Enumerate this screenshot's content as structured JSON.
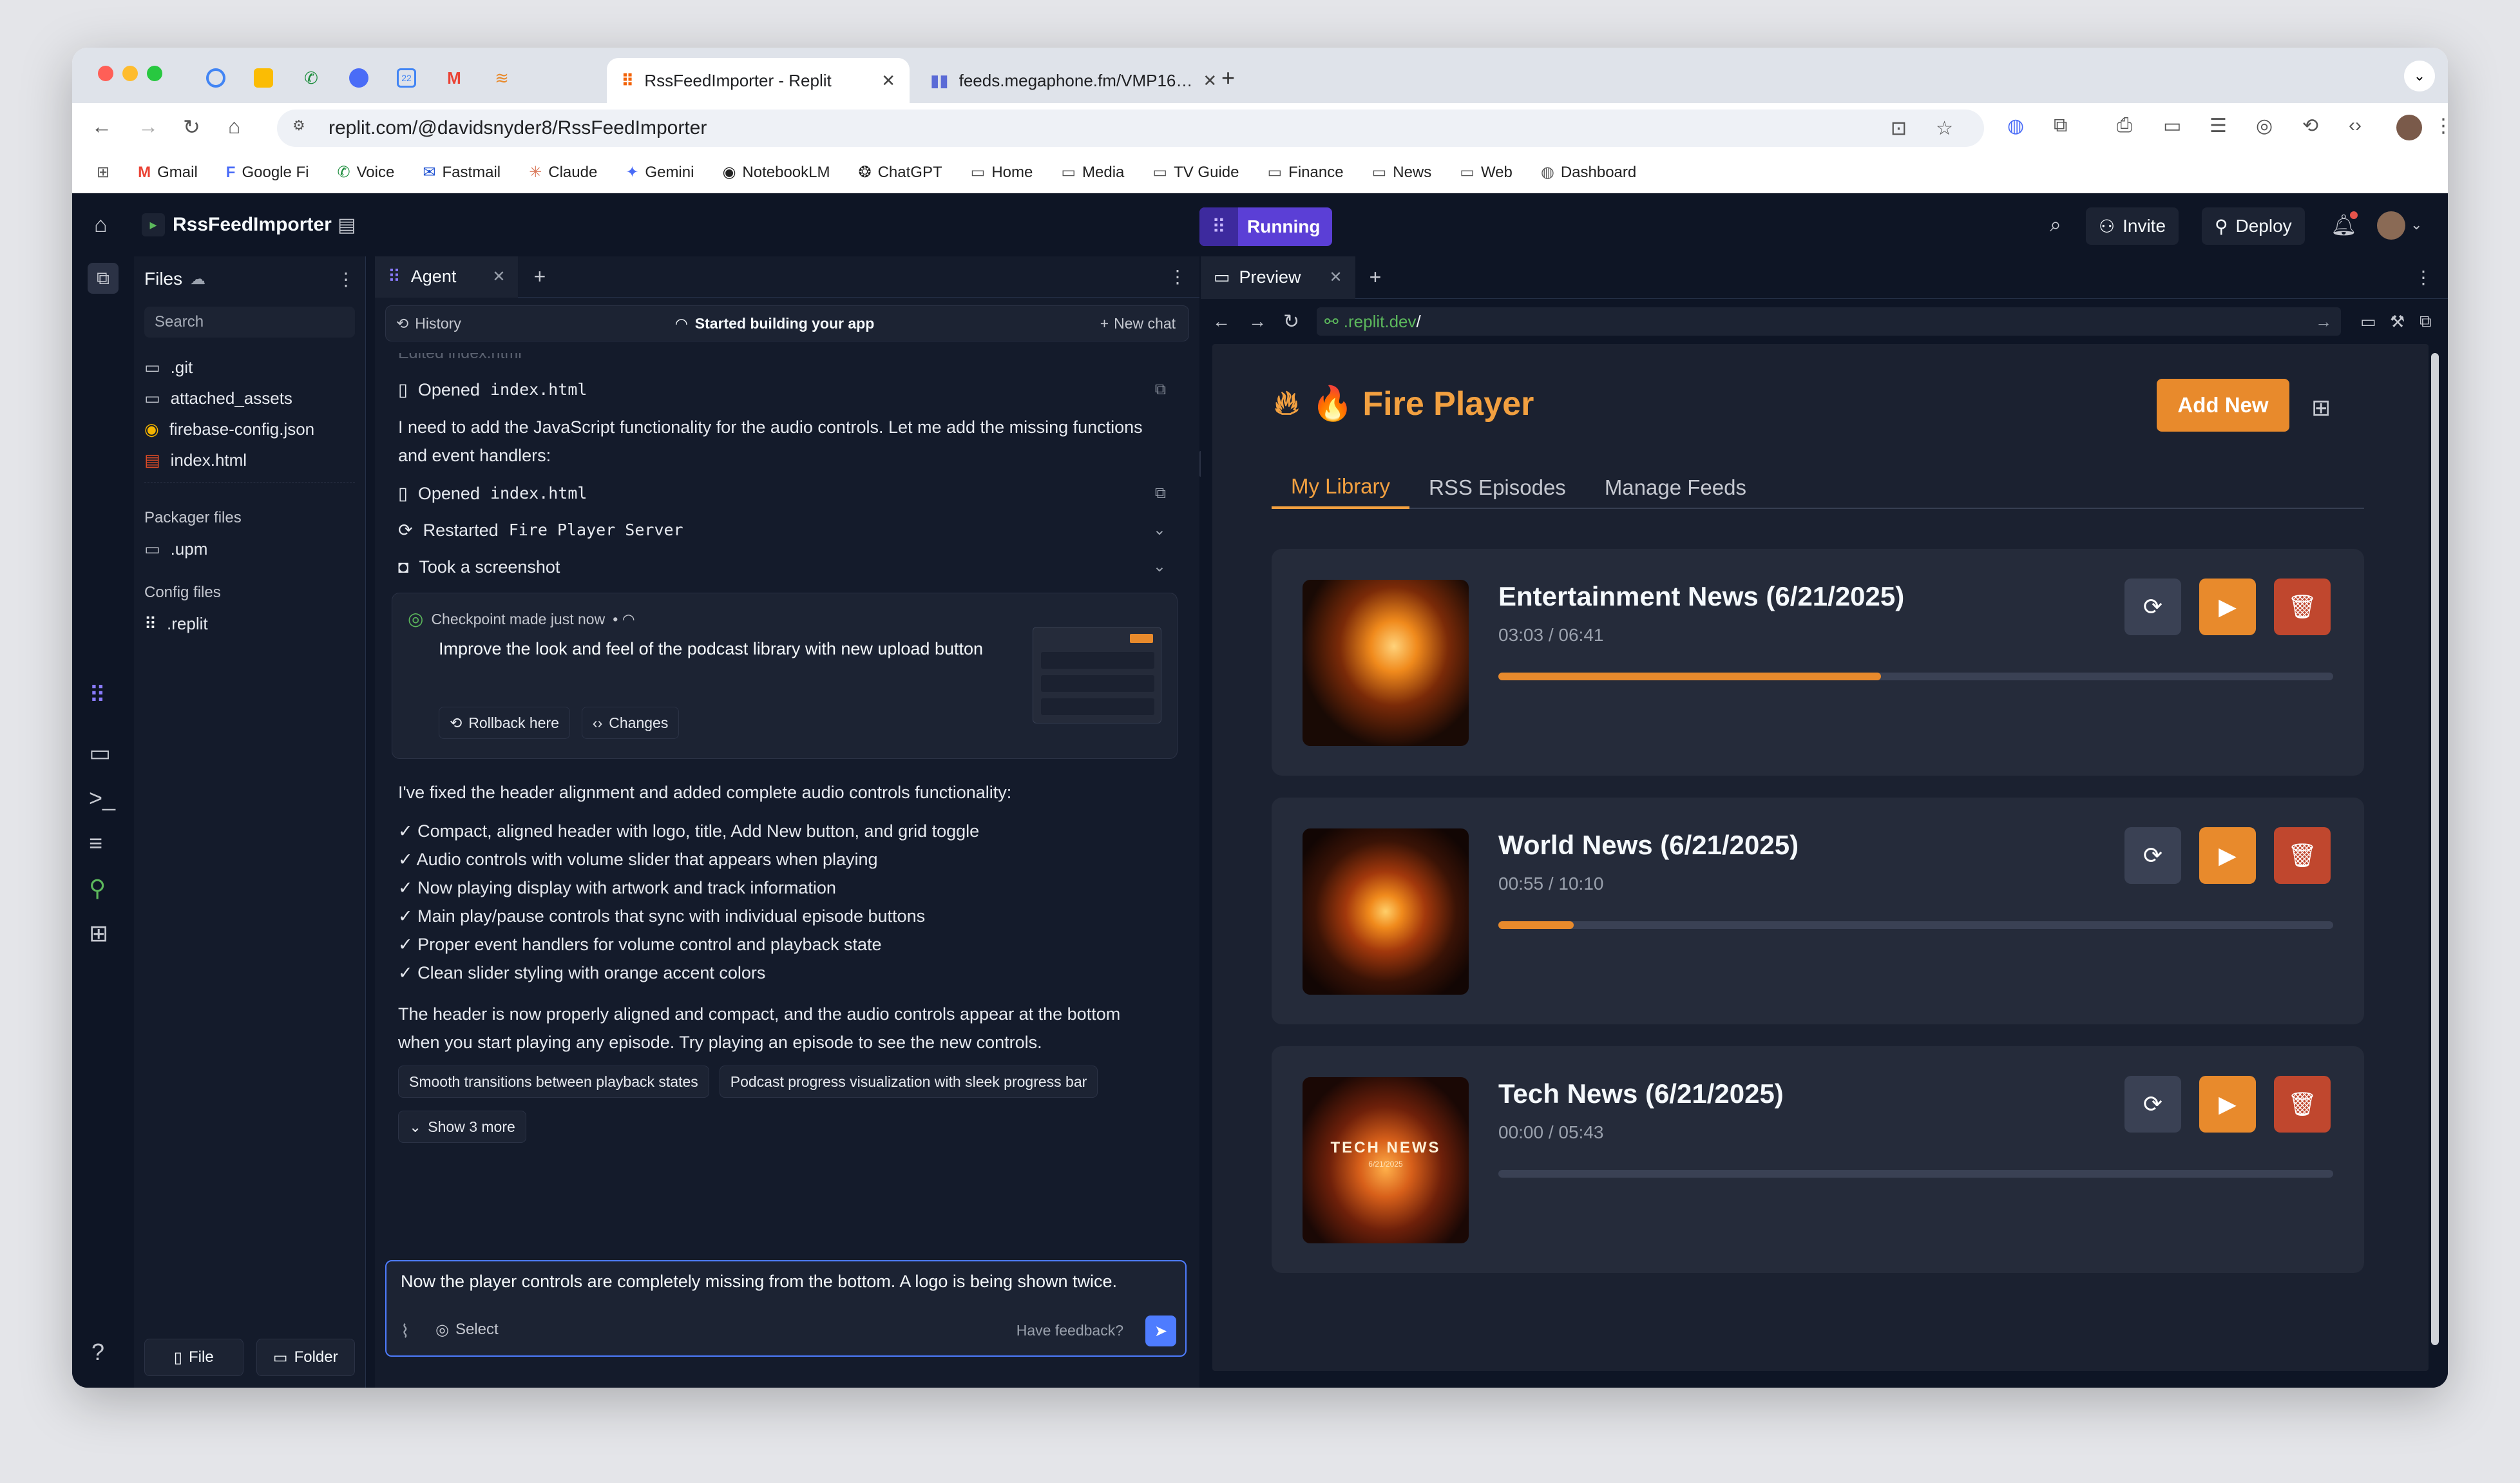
{
  "browser": {
    "pinned_tabs": [
      "task-icon",
      "keep-icon",
      "voice-icon",
      "chat-icon",
      "calendar-icon",
      "gmail-icon",
      "stack-icon"
    ],
    "tabs": [
      {
        "title": "RssFeedImporter - Replit",
        "active": true
      },
      {
        "title": "feeds.megaphone.fm/VMP16…",
        "active": false
      }
    ],
    "url": "replit.com/@davidsnyder8/RssFeedImporter",
    "bookmarks": [
      "Gmail",
      "Google Fi",
      "Voice",
      "Fastmail",
      "Claude",
      "Gemini",
      "NotebookLM",
      "ChatGPT",
      "Home",
      "Media",
      "TV Guide",
      "Finance",
      "News",
      "Web",
      "Dashboard"
    ]
  },
  "app": {
    "project_name": "RssFeedImporter",
    "status": "Running",
    "invite": "Invite",
    "deploy": "Deploy"
  },
  "files": {
    "header": "Files",
    "search_placeholder": "Search",
    "items": [
      ".git",
      "attached_assets",
      "firebase-config.json",
      "index.html"
    ],
    "packager_label": "Packager files",
    "packager_items": [
      ".upm"
    ],
    "config_label": "Config files",
    "config_items": [
      ".replit"
    ],
    "new_file": "File",
    "new_folder": "Folder"
  },
  "agent": {
    "tab_label": "Agent",
    "history": "History",
    "status": "Started building your app",
    "new_chat": "New chat",
    "cut_line": "Edited index.html",
    "act1": {
      "label": "Opened",
      "file": "index.html"
    },
    "msg1": "I need to add the JavaScript functionality for the audio controls. Let me add the missing functions and event handlers:",
    "act2": {
      "label": "Opened",
      "file": "index.html"
    },
    "act3": {
      "label": "Restarted",
      "file": "Fire Player Server"
    },
    "act4": {
      "label": "Took a screenshot"
    },
    "checkpoint": {
      "label": "Checkpoint made just now",
      "desc": "Improve the look and feel of the podcast library with new upload button",
      "rollback": "Rollback here",
      "changes": "Changes"
    },
    "summary_intro": "I've fixed the header alignment and added complete audio controls functionality:",
    "bullets": [
      "✓ Compact, aligned header with logo, title, Add New button, and grid toggle",
      "✓ Audio controls with volume slider that appears when playing",
      "✓ Now playing display with artwork and track information",
      "✓ Main play/pause controls that sync with individual episode buttons",
      "✓ Proper event handlers for volume control and playback state",
      "✓ Clean slider styling with orange accent colors"
    ],
    "closing": "The header is now properly aligned and compact, and the audio controls appear at the bottom when you start playing any episode. Try playing an episode to see the new controls.",
    "suggestions": [
      "Smooth transitions between playback states",
      "Podcast progress visualization with sleek progress bar"
    ],
    "show_more": "Show 3 more",
    "input_value": "Now the player controls are completely missing from the bottom. A logo is being shown twice.",
    "select": "Select",
    "feedback": "Have feedback?"
  },
  "preview": {
    "tab_label": "Preview",
    "url_host": ".replit.dev",
    "url_path": "/",
    "app_title": "🔥 Fire Player",
    "add_new": "Add New",
    "tabs": [
      "My Library",
      "RSS Episodes",
      "Manage Feeds"
    ],
    "active_tab": "My Library",
    "episodes": [
      {
        "title": "Entertainment News (6/21/2025)",
        "time": "03:03 / 06:41",
        "progress": 0.458
      },
      {
        "title": "World News (6/21/2025)",
        "time": "00:55 / 10:10",
        "progress": 0.09
      },
      {
        "title": "Tech News (6/21/2025)",
        "time": "00:00 / 05:43",
        "progress": 0.0,
        "art_text": "TECH NEWS",
        "art_date": "6/21/2025"
      }
    ]
  },
  "colors": {
    "accent": "#e88a2c",
    "danger": "#c0472e",
    "running": "#5b3fd6",
    "bg": "#0e1525"
  }
}
